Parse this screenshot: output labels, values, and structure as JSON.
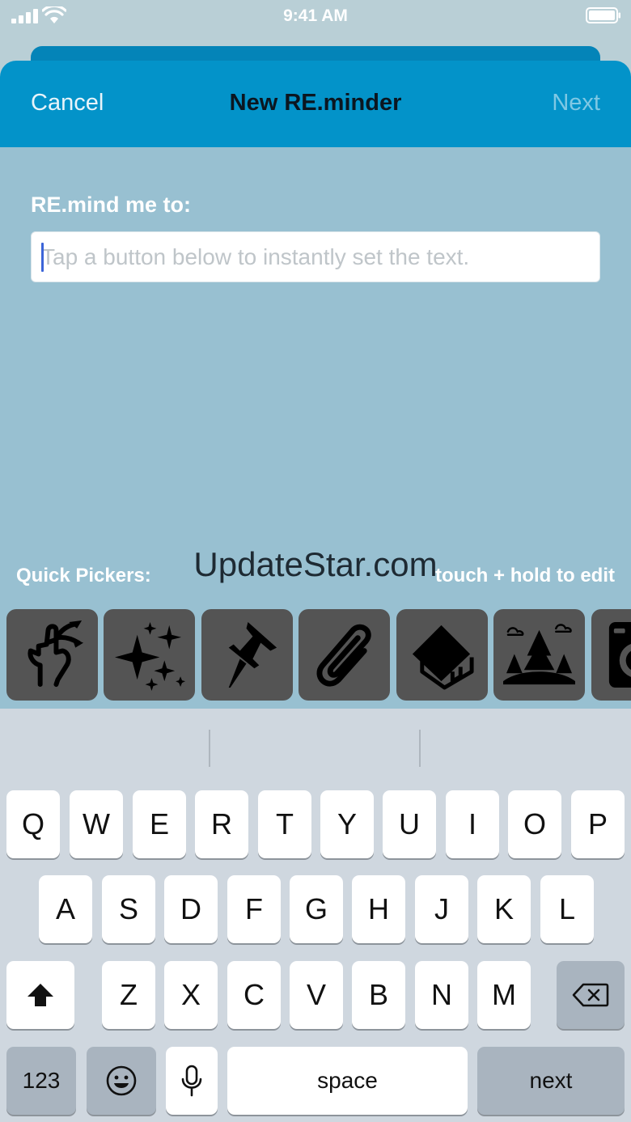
{
  "status": {
    "time": "9:41 AM"
  },
  "nav": {
    "cancel": "Cancel",
    "title": "New RE.minder",
    "next": "Next"
  },
  "form": {
    "label": "RE.mind me to:",
    "placeholder": "Tap a button below to instantly set the text."
  },
  "quick": {
    "label": "Quick Pickers:",
    "watermark": "UpdateStar.com",
    "hint": "touch + hold to edit",
    "items": [
      "finger-string-icon",
      "sparkles-icon",
      "pushpin-icon",
      "paperclip-icon",
      "house-icon",
      "forest-icon",
      "washing-machine-icon"
    ]
  },
  "keyboard": {
    "row1": [
      "Q",
      "W",
      "E",
      "R",
      "T",
      "Y",
      "U",
      "I",
      "O",
      "P"
    ],
    "row2": [
      "A",
      "S",
      "D",
      "F",
      "G",
      "H",
      "J",
      "K",
      "L"
    ],
    "row3": [
      "Z",
      "X",
      "C",
      "V",
      "B",
      "N",
      "M"
    ],
    "numbers": "123",
    "space": "space",
    "return": "next"
  },
  "colors": {
    "nav": "#0393c9",
    "content": "#98c0d1",
    "picker": "#545454",
    "keyboard": "#cfd7df"
  }
}
